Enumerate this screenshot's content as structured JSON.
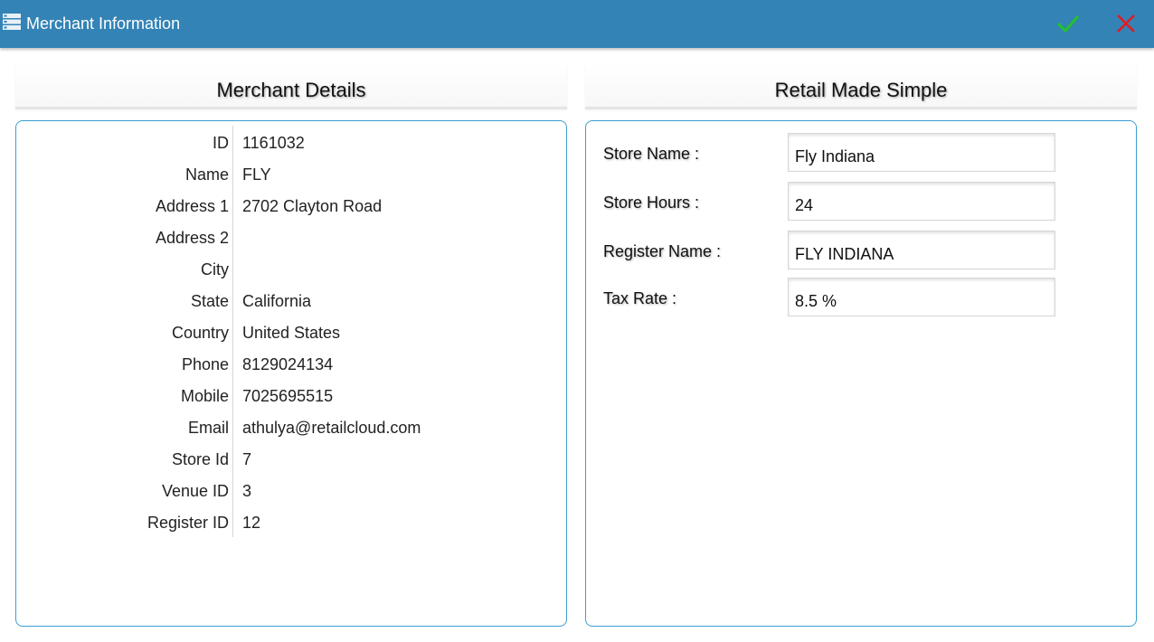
{
  "window": {
    "title": "Merchant Information",
    "app_icon": "list-menu-icon",
    "confirm_icon": "checkmark-icon",
    "close_icon": "close-icon",
    "colors": {
      "titlebar": "#3383b6",
      "confirm": "#22c22a",
      "close": "#e11b22",
      "border": "#3a9fd1"
    }
  },
  "left_panel": {
    "heading": "Merchant Details",
    "rows": [
      {
        "label": "ID",
        "value": "1161032"
      },
      {
        "label": "Name",
        "value": "FLY"
      },
      {
        "label": "Address 1",
        "value": "2702 Clayton Road"
      },
      {
        "label": "Address 2",
        "value": ""
      },
      {
        "label": "City",
        "value": ""
      },
      {
        "label": "State",
        "value": "California"
      },
      {
        "label": "Country",
        "value": "United States"
      },
      {
        "label": "Phone",
        "value": "8129024134"
      },
      {
        "label": "Mobile",
        "value": "7025695515"
      },
      {
        "label": "Email",
        "value": "athulya@retailcloud.com"
      },
      {
        "label": "Store Id",
        "value": "7"
      },
      {
        "label": "Venue ID",
        "value": "3"
      },
      {
        "label": "Register ID",
        "value": "12"
      }
    ]
  },
  "right_panel": {
    "heading": "Retail Made Simple",
    "fields": {
      "store_name": {
        "label": "Store Name :",
        "value": "Fly Indiana"
      },
      "store_hours": {
        "label": "Store Hours :",
        "value": "24"
      },
      "register_name": {
        "label": "Register Name :",
        "value": "FLY INDIANA"
      },
      "tax_rate": {
        "label": "Tax Rate :",
        "value": "8.5 %"
      }
    }
  }
}
